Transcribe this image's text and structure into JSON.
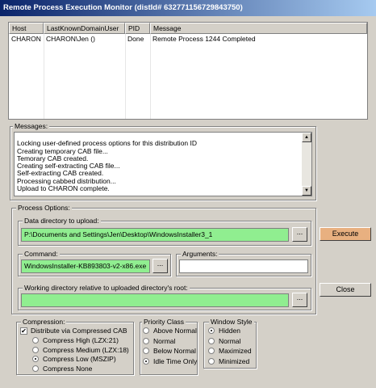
{
  "window": {
    "title": "Remote Process Execution Monitor (distId# 632771156729843750)"
  },
  "list": {
    "columns": [
      "Host",
      "LastKnownDomainUser",
      "PID",
      "Message"
    ],
    "rows": [
      {
        "host": "CHARON",
        "user": "CHARON\\Jen ()",
        "pid": "Done",
        "message": "Remote Process 1244 Completed"
      }
    ]
  },
  "messages": {
    "label": "Messages:",
    "lines": [
      "",
      "Locking user-defined process options for this distribution ID",
      "Creating temporary CAB file...",
      "Temorary CAB created.",
      "Creating self-extracting CAB file...",
      "Self-extracting CAB created.",
      "Processing cabbed distribution...",
      "Upload to CHARON complete."
    ]
  },
  "process_options": {
    "label": "Process Options:",
    "data_dir_label": "Data directory to upload:",
    "data_dir_value": "P:\\Documents and Settings\\Jen\\Desktop\\WindowsInstaller3_1",
    "command_label": "Command:",
    "command_value": "WindowsInstaller-KB893803-v2-x86.exe",
    "arguments_label": "Arguments:",
    "arguments_value": "",
    "workdir_label": "Working directory relative to uploaded directory's root:",
    "workdir_value": "",
    "browse_label": "..."
  },
  "buttons": {
    "execute": "Execute",
    "close": "Close"
  },
  "compression": {
    "label": "Compression:",
    "distribute_label": "Distribute via Compressed CAB",
    "distribute_checked": true,
    "options": [
      {
        "label": "Compress High  (LZX:21)",
        "selected": false
      },
      {
        "label": "Compress Medium (LZX:18)",
        "selected": false
      },
      {
        "label": "Compress Low  (MSZIP)",
        "selected": true
      },
      {
        "label": "Compress None",
        "selected": false
      }
    ]
  },
  "priority": {
    "label": "Priority Class",
    "options": [
      {
        "label": "Above Normal",
        "selected": false
      },
      {
        "label": "Normal",
        "selected": false
      },
      {
        "label": "Below Normal",
        "selected": false
      },
      {
        "label": "Idle Time Only",
        "selected": true
      }
    ]
  },
  "window_style": {
    "label": "Window Style",
    "options": [
      {
        "label": "Hidden",
        "selected": true
      },
      {
        "label": "Normal",
        "selected": false
      },
      {
        "label": "Maximized",
        "selected": false
      },
      {
        "label": "Minimized",
        "selected": false
      }
    ]
  },
  "colors": {
    "field_green": "#90ee90",
    "title_blue": "#0a246a"
  }
}
